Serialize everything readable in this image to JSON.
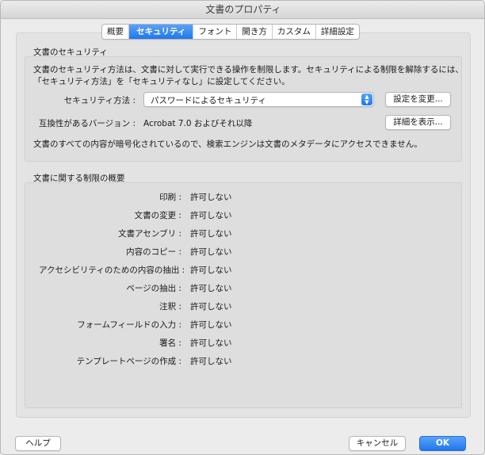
{
  "window": {
    "title": "文書のプロパティ"
  },
  "tabs": [
    {
      "label": "概要"
    },
    {
      "label": "セキュリティ",
      "active": true
    },
    {
      "label": "フォント"
    },
    {
      "label": "開き方"
    },
    {
      "label": "カスタム"
    },
    {
      "label": "詳細設定"
    }
  ],
  "security": {
    "heading": "文書のセキュリティ",
    "description_line1": "文書のセキュリティ方法は、文書に対して実行できる操作を制限します。セキュリティによる制限を解除するには、",
    "description_line2": "「セキュリティ方法」を「セキュリティなし」に設定してください。",
    "method_label": "セキュリティ方法 :",
    "method_value": "パスワードによるセキュリティ",
    "change_settings_button": "設定を変更...",
    "compat_label": "互換性があるバージョン :",
    "compat_value": "Acrobat 7.0 およびそれ以降",
    "show_details_button": "詳細を表示...",
    "encryption_note": "文書のすべての内容が暗号化されているので、検索エンジンは文書のメタデータにアクセスできません。"
  },
  "restrictions": {
    "heading": "文書に関する制限の概要",
    "items": [
      {
        "label": "印刷 :",
        "value": "許可しない"
      },
      {
        "label": "文書の変更 :",
        "value": "許可しない"
      },
      {
        "label": "文書アセンブリ :",
        "value": "許可しない"
      },
      {
        "label": "内容のコピー :",
        "value": "許可しない"
      },
      {
        "label": "アクセシビリティのための内容の抽出 :",
        "value": "許可しない"
      },
      {
        "label": "ページの抽出 :",
        "value": "許可しない"
      },
      {
        "label": "注釈 :",
        "value": "許可しない"
      },
      {
        "label": "フォームフィールドの入力 :",
        "value": "許可しない"
      },
      {
        "label": "署名 :",
        "value": "許可しない"
      },
      {
        "label": "テンプレートページの作成 :",
        "value": "許可しない"
      }
    ]
  },
  "footer": {
    "help_button": "ヘルプ",
    "cancel_button": "キャンセル",
    "ok_button": "OK"
  },
  "colors": {
    "accent": "#1f77ee",
    "window_bg": "#ececec",
    "panel_bg": "#e3e3e3"
  }
}
